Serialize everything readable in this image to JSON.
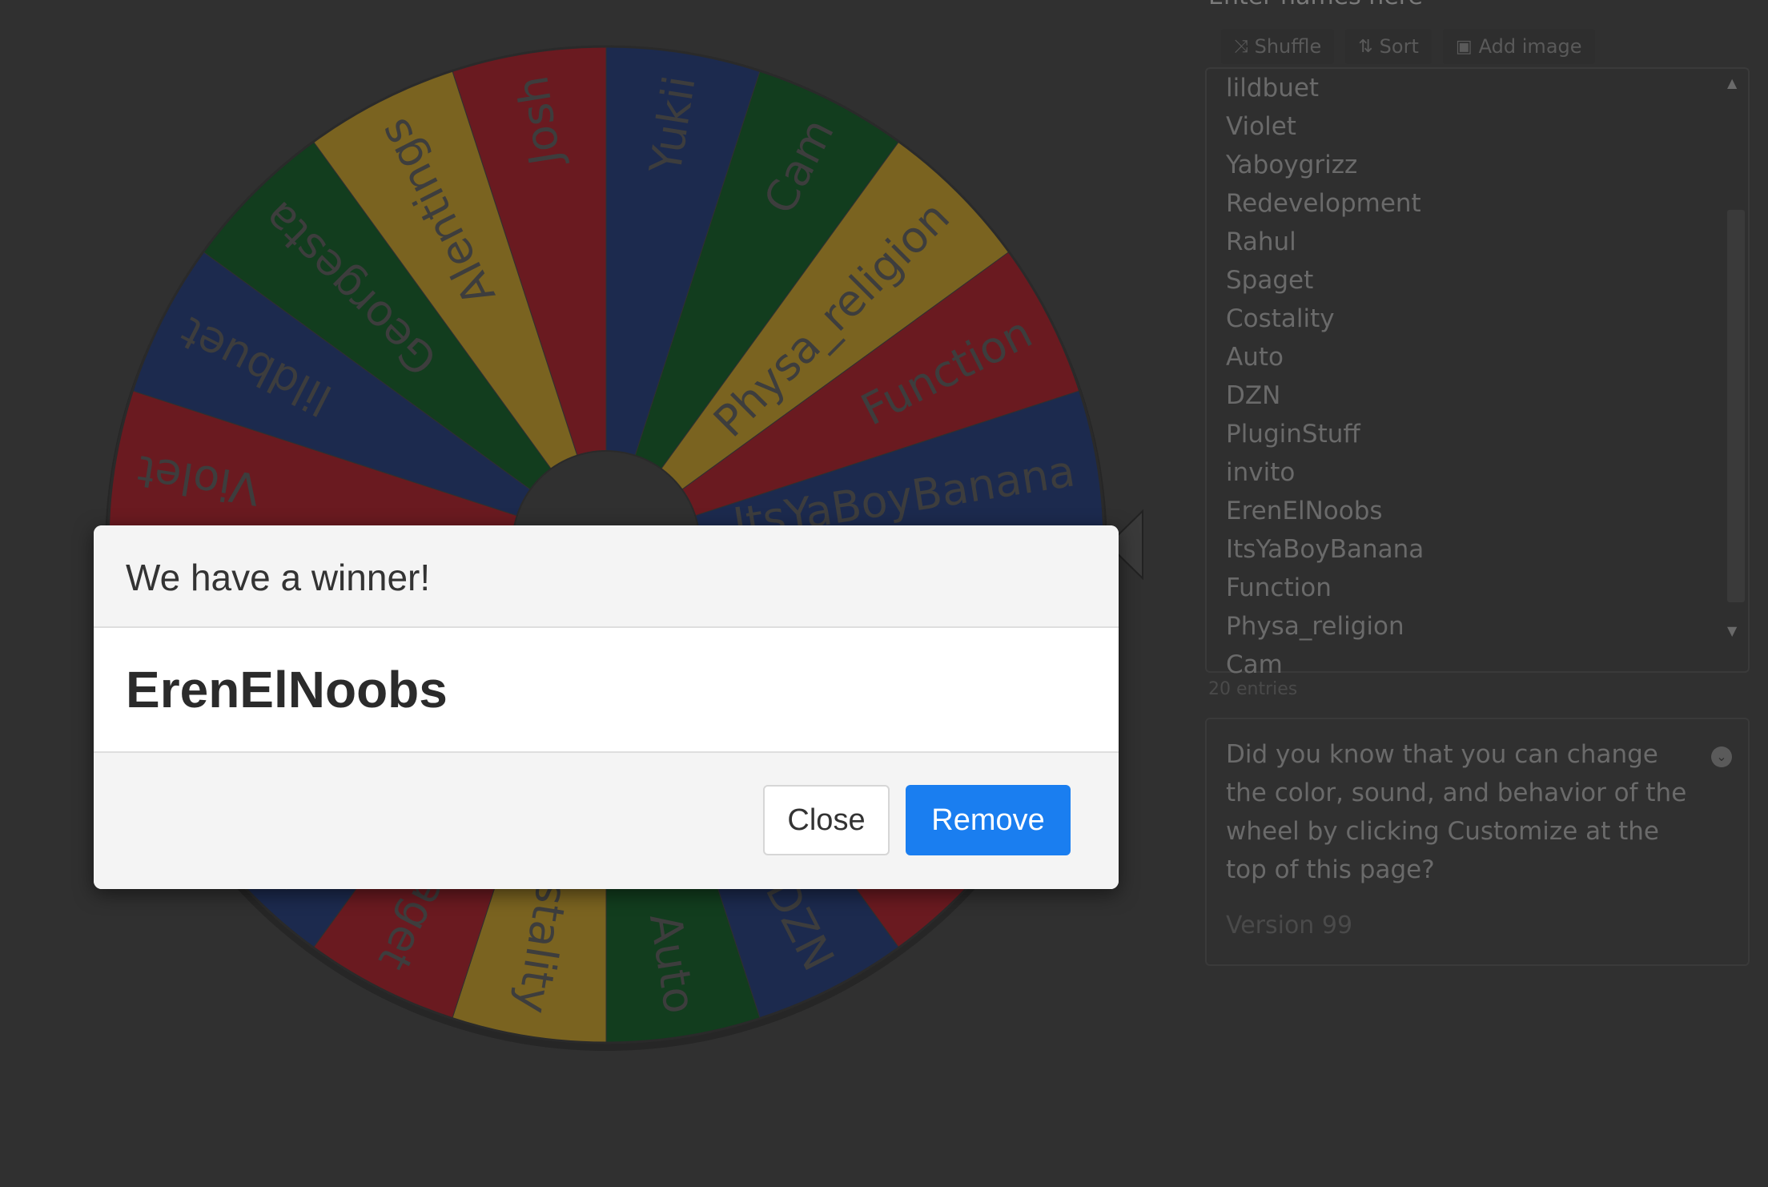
{
  "wheel": {
    "entries": [
      "Josh",
      "Yukii",
      "Cam",
      "Physa_religion",
      "Function",
      "ItsYaBoyBanana",
      "ErenElNoobs",
      "invito",
      "PluginStuff",
      "DZN",
      "Auto",
      "Costality",
      "Spaget",
      "Rahul",
      "Redevelopment",
      "Yaboygrizz",
      "Violet",
      "lildbuet",
      "Georgesta",
      "Alentings"
    ],
    "colors": [
      "#6a1a20",
      "#1c2a4e",
      "#123d1e",
      "#7a6320"
    ],
    "pointer_color": "#d8d8d8"
  },
  "panel": {
    "placeholder": "Enter names here",
    "toolbar": {
      "shuffle_label": "Shuffle",
      "sort_label": "Sort",
      "add_image_label": "Add image"
    },
    "names": [
      "lildbuet",
      "Violet",
      "Yaboygrizz",
      "Redevelopment",
      "Rahul",
      "Spaget",
      "Costality",
      "Auto",
      "DZN",
      "PluginStuff",
      "invito",
      "ErenElNoobs",
      "ItsYaBoyBanana",
      "Function",
      "Physa_religion",
      "Cam"
    ],
    "count_text": "20 entries",
    "tip_text": "Did you know that you can change the color, sound, and behavior of the wheel by clicking Customize at the top of this page?",
    "version": "Version 99"
  },
  "modal": {
    "title": "We have a winner!",
    "winner": "ErenElNoobs",
    "close_label": "Close",
    "remove_label": "Remove",
    "remove_color": "#1a7ef0"
  }
}
